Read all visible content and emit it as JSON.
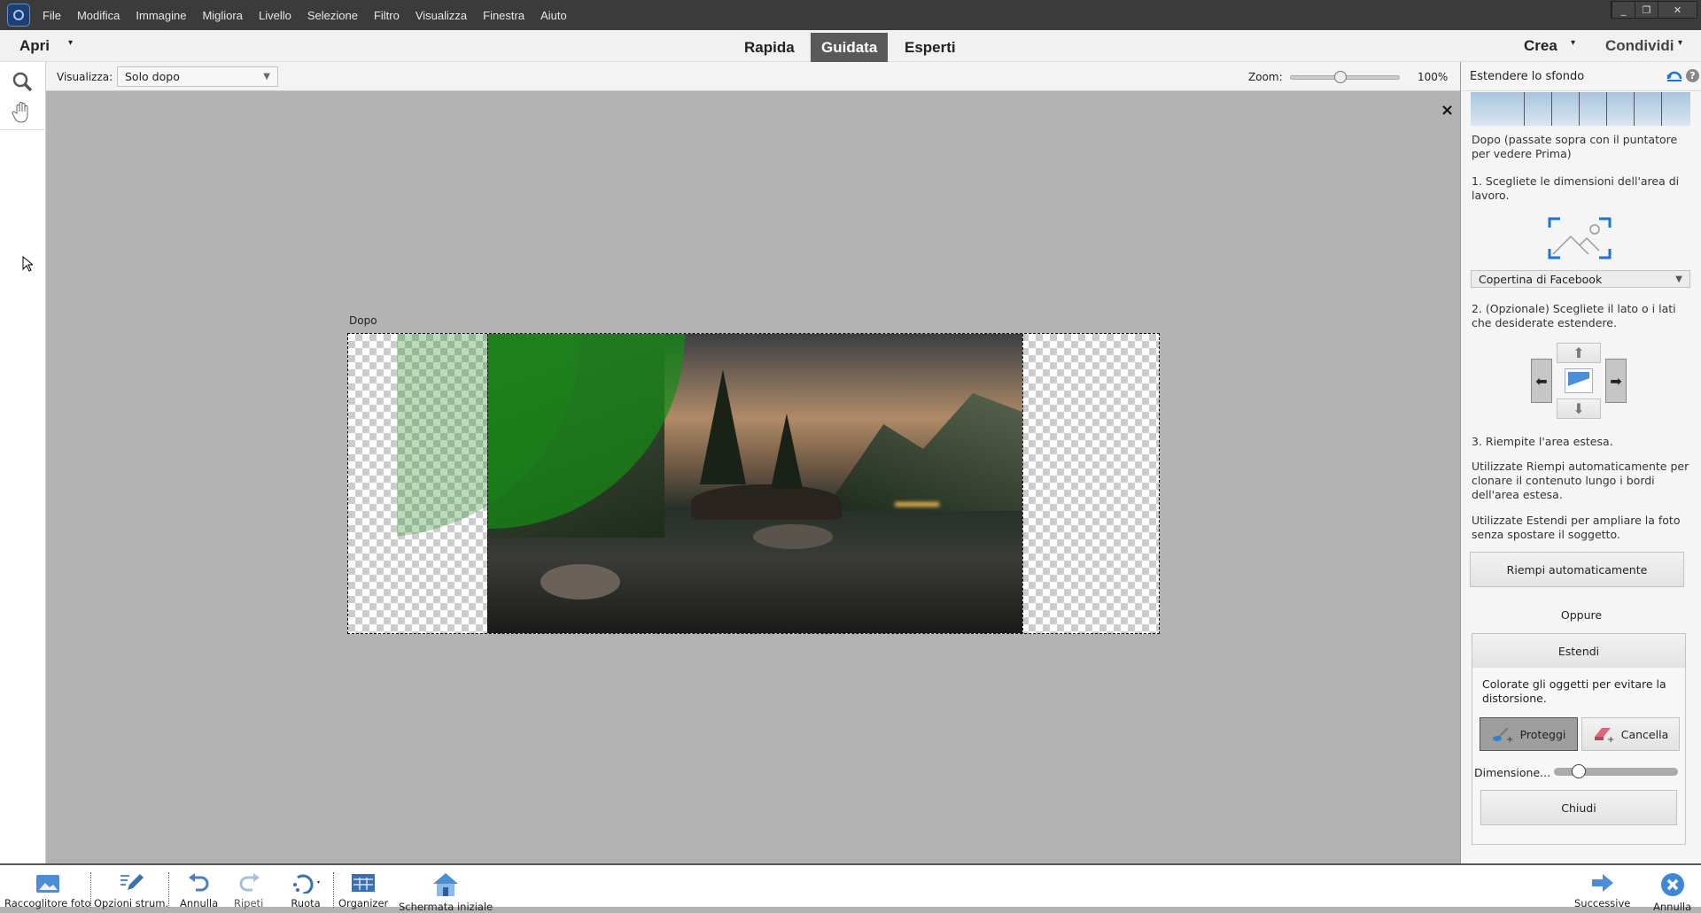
{
  "app": {
    "menu": [
      "File",
      "Modifica",
      "Immagine",
      "Migliora",
      "Livello",
      "Selezione",
      "Filtro",
      "Visualizza",
      "Finestra",
      "Aiuto"
    ],
    "window_controls": [
      "_",
      "❐",
      "✕"
    ]
  },
  "modebar": {
    "open": "Apri",
    "tabs": [
      "Rapida",
      "Guidata",
      "Esperti"
    ],
    "active_tab": "Guidata",
    "create": "Crea",
    "share": "Condividi"
  },
  "options": {
    "view_label": "Visualizza:",
    "view_value": "Solo dopo",
    "zoom_label": "Zoom:",
    "zoom_value": "100%",
    "zoom_fraction": 0.45
  },
  "canvas": {
    "image_label": "Dopo",
    "close": "×"
  },
  "panel": {
    "title": "Estendere lo sfondo",
    "preview_caption": "Dopo (passate sopra con il puntatore per vedere Prima)",
    "step1": "1. Scegliete le dimensioni dell'area di lavoro.",
    "size_preset": "Copertina di Facebook",
    "step2": "2. (Opzionale) Scegliete il lato o i lati che desiderate estendere.",
    "step3": "3. Riempite l'area estesa.",
    "autofill_help": "Utilizzate Riempi automaticamente per clonare il contenuto lungo i bordi dell'area estesa.",
    "extend_help": "Utilizzate Estendi per ampliare la foto senza spostare il soggetto.",
    "autofill_button": "Riempi automaticamente",
    "or": "Oppure",
    "extend_button": "Estendi",
    "paint_help": "Colorate gli oggetti per evitare la distorsione.",
    "protect": "Proteggi",
    "erase": "Cancella",
    "size_label": "Dimensione...",
    "brush_size_fraction": 0.2,
    "close_button": "Chiudi"
  },
  "bottom": {
    "items": [
      "Raccoglitore foto",
      "Opzioni strum.",
      "Annulla",
      "Ripeti",
      "Ruota",
      "Organizer",
      "Schermata iniziale"
    ],
    "next": "Successive",
    "cancel": "Annulla"
  },
  "colors": {
    "accent": "#1a73d9",
    "active_tab": "#595959",
    "protect_mask": "#1f8a1f"
  }
}
